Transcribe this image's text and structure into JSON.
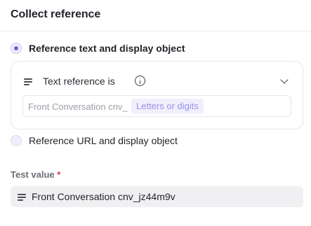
{
  "title": "Collect reference",
  "options": [
    {
      "label": "Reference text and display object",
      "selected": true
    },
    {
      "label": "Reference URL and display object",
      "selected": false
    }
  ],
  "text_reference": {
    "label": "Text reference is",
    "input_prefix": "Front Conversation cnv_",
    "token": "Letters or digits"
  },
  "test_value": {
    "label": "Test value",
    "required_marker": "*",
    "value": "Front Conversation cnv_jz44m9v"
  },
  "colors": {
    "accent": "#6b63d9",
    "token_text": "#9a93e6",
    "token_bg": "#f1effc",
    "required": "#d8323c"
  }
}
